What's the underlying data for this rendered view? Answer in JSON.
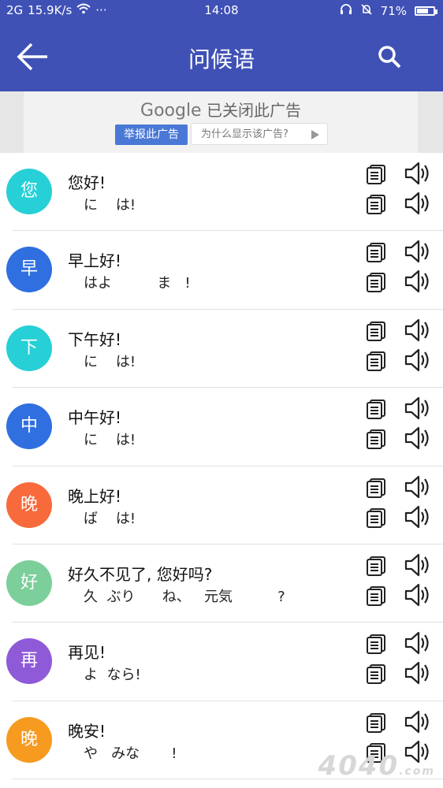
{
  "status_bar": {
    "signal": "2G",
    "speed": "15.9K/s",
    "dots": "···",
    "time": "14:08",
    "battery": "71%",
    "battery_level": 0.71
  },
  "app_bar": {
    "title": "问候语"
  },
  "ad": {
    "brand": "Google",
    "closed_text": "已关闭此广告",
    "report_button": "举报此广告",
    "why_button": "为什么显示该广告?"
  },
  "items": [
    {
      "avatar": "您",
      "color": "#26d0d6",
      "chinese": "您好!",
      "japanese": "に    は!"
    },
    {
      "avatar": "早",
      "color": "#2f6fe0",
      "chinese": "早上好!",
      "japanese": "はよ          ま   !"
    },
    {
      "avatar": "下",
      "color": "#26d0d6",
      "chinese": "下午好!",
      "japanese": "に    は!"
    },
    {
      "avatar": "中",
      "color": "#2f6fe0",
      "chinese": "中午好!",
      "japanese": "に    は!"
    },
    {
      "avatar": "晚",
      "color": "#f86a3c",
      "chinese": "晚上好!",
      "japanese": "ば    は!"
    },
    {
      "avatar": "好",
      "color": "#7ccf9a",
      "chinese": "好久不见了, 您好吗?",
      "japanese": "久  ぶり      ね、   元気          ?"
    },
    {
      "avatar": "再",
      "color": "#8e5ad8",
      "chinese": "再见!",
      "japanese": "よ  なら!"
    },
    {
      "avatar": "晚",
      "color": "#f79a20",
      "chinese": "晚安!",
      "japanese": "や   みな       !"
    }
  ],
  "watermark": {
    "text": "4040",
    "suffix": ".com"
  }
}
